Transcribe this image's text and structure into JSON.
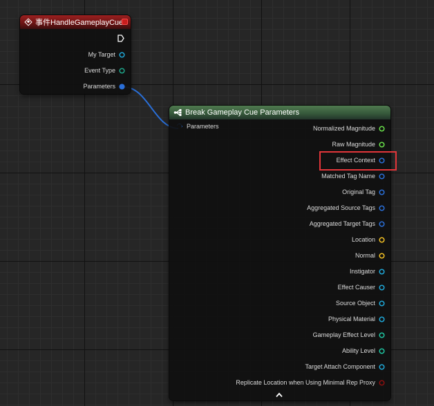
{
  "event_node": {
    "title": "事件HandleGameplayCue",
    "pins": [
      {
        "label": "My Target",
        "color": "#1fa8d8",
        "filled": false
      },
      {
        "label": "Event Type",
        "color": "#1ea68a",
        "filled": false
      },
      {
        "label": "Parameters",
        "color": "#2a6fd8",
        "filled": true
      }
    ]
  },
  "break_node": {
    "title": "Break Gameplay Cue Parameters",
    "input_pin": {
      "label": "Parameters",
      "color": "#2a6fd8"
    },
    "outputs": [
      {
        "label": "Normalized Magnitude",
        "color": "#69e04a"
      },
      {
        "label": "Raw Magnitude",
        "color": "#69e04a"
      },
      {
        "label": "Effect Context",
        "color": "#2a6fd8"
      },
      {
        "label": "Matched Tag Name",
        "color": "#2a6fd8"
      },
      {
        "label": "Original Tag",
        "color": "#2a6fd8"
      },
      {
        "label": "Aggregated Source Tags",
        "color": "#2a6fd8"
      },
      {
        "label": "Aggregated Target Tags",
        "color": "#2a6fd8"
      },
      {
        "label": "Location",
        "color": "#f2c024"
      },
      {
        "label": "Normal",
        "color": "#f2c024"
      },
      {
        "label": "Instigator",
        "color": "#1fa8d8"
      },
      {
        "label": "Effect Causer",
        "color": "#1fa8d8"
      },
      {
        "label": "Source Object",
        "color": "#1fa8d8"
      },
      {
        "label": "Physical Material",
        "color": "#1fa8d8"
      },
      {
        "label": "Gameplay Effect Level",
        "color": "#1ec4a0"
      },
      {
        "label": "Ability Level",
        "color": "#1ec4a0"
      },
      {
        "label": "Target Attach Component",
        "color": "#1fa8d8"
      },
      {
        "label": "Replicate Location when Using Minimal Rep Proxy",
        "color": "#8b0f0f"
      }
    ]
  },
  "annotation": {
    "color": "#e3363a",
    "target": "Effect Context"
  },
  "icons": [
    "event-icon",
    "close-icon",
    "exec-pin-icon",
    "break-struct-icon",
    "collapse-arrow-icon"
  ]
}
